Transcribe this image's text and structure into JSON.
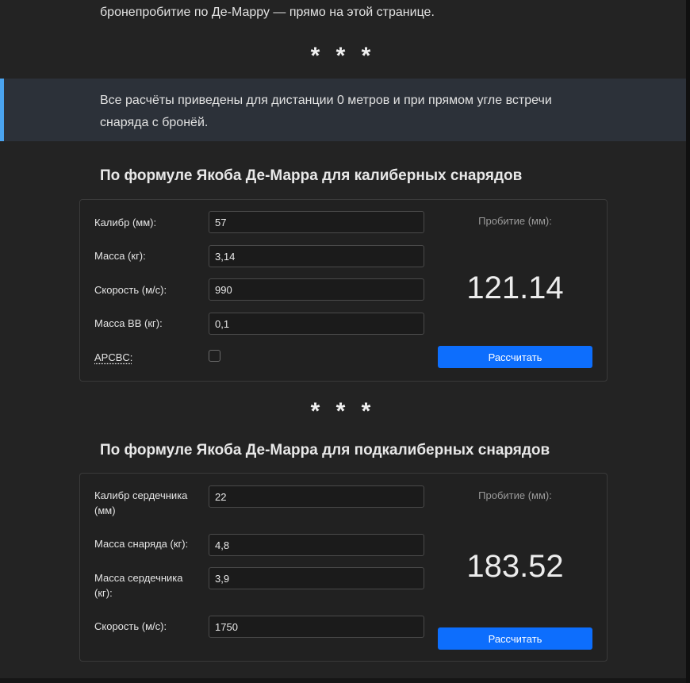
{
  "intro": {
    "tail_text": "бронепробитие по Де-Марру — прямо на этой странице."
  },
  "divider_symbol": "* * *",
  "notice": {
    "text": "Все расчёты приведены для дистанции 0 метров и при прямом угле встречи снаряда с бронёй.",
    "accent_color": "#4aa3ef"
  },
  "caliber_calc": {
    "title": "По формуле Якоба Де-Марра для калиберных снарядов",
    "fields": {
      "caliber": {
        "label": "Калибр (мм):",
        "value": "57"
      },
      "mass": {
        "label": "Масса (кг):",
        "value": "3,14"
      },
      "velocity": {
        "label": "Скорость (м/с):",
        "value": "990"
      },
      "explosive_mass": {
        "label": "Масса ВВ (кг):",
        "value": "0,1"
      },
      "apcbc": {
        "label": "APCBC:",
        "checked": false
      }
    },
    "result_label": "Пробитие (мм):",
    "result_value": "121.14",
    "button_label": "Рассчитать"
  },
  "subcaliber_calc": {
    "title": "По формуле Якоба Де-Марра для подкалиберных снарядов",
    "fields": {
      "core_caliber": {
        "label": "Калибр сердечника (мм)",
        "value": "22"
      },
      "shell_mass": {
        "label": "Масса снаряда (кг):",
        "value": "4,8"
      },
      "core_mass": {
        "label": "Масса сердечника (кг):",
        "value": "3,9"
      },
      "velocity": {
        "label": "Скорость (м/с):",
        "value": "1750"
      }
    },
    "result_label": "Пробитие (мм):",
    "result_value": "183.52",
    "button_label": "Рассчитать"
  },
  "colors": {
    "primary_button": "#0d6efd",
    "page_background": "#232323",
    "notice_background": "#2c3139"
  }
}
